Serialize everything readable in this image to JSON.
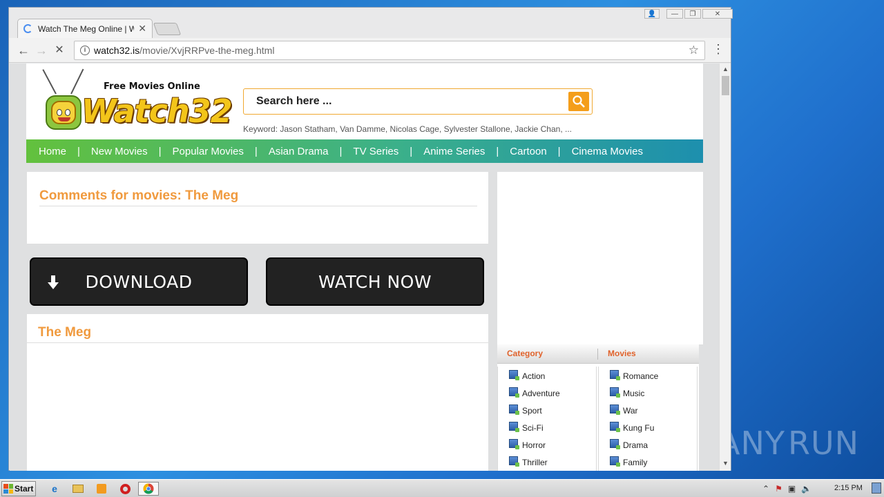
{
  "browser": {
    "tab_title": "Watch The Meg Online | Wa",
    "url_host": "watch32.is",
    "url_path": "/movie/XvjRRPve-the-meg.html"
  },
  "site": {
    "tagline": "Free Movies Online",
    "brand": "Watch32",
    "search_placeholder": "Search here ...",
    "keywords": "Keyword: Jason Statham, Van Damme, Nicolas Cage, Sylvester Stallone, Jackie Chan, ...",
    "nav": [
      "Home",
      "New Movies",
      "Popular Movies",
      "Asian Drama",
      "TV Series",
      "Anime Series",
      "Cartoon",
      "Cinema Movies"
    ]
  },
  "main": {
    "comments_title": "Comments for movies: The Meg",
    "download_label": "DOWNLOAD",
    "watch_label": "WATCH NOW",
    "movie_title": "The Meg"
  },
  "sidebar": {
    "category_header": "Category",
    "movies_header": "Movies",
    "category_items": [
      "Action",
      "Adventure",
      "Sport",
      "Sci-Fi",
      "Horror",
      "Thriller"
    ],
    "movies_items": [
      "Romance",
      "Music",
      "War",
      "Kung Fu",
      "Drama",
      "Family"
    ]
  },
  "taskbar": {
    "start_label": "Start",
    "clock": "2:15 PM"
  },
  "desktop": {
    "watermark": "ANY RUN"
  },
  "colors": {
    "accent_orange": "#f09a3e",
    "category_red": "#e0622b",
    "nav_green": "#63c13d",
    "nav_teal": "#1d8fae"
  }
}
